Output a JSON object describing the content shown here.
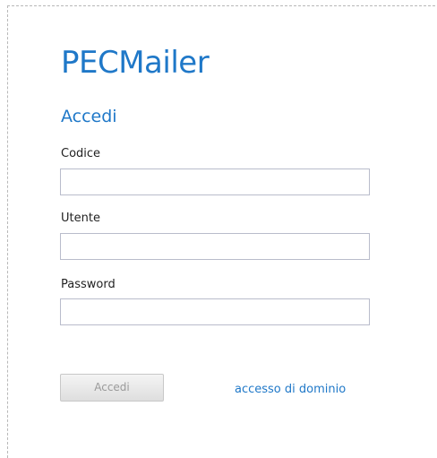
{
  "app": {
    "title": "PECMailer"
  },
  "form": {
    "heading": "Accedi",
    "fields": [
      {
        "label": "Codice",
        "value": "",
        "placeholder": ""
      },
      {
        "label": "Utente",
        "value": "",
        "placeholder": ""
      },
      {
        "label": "Password",
        "value": "",
        "placeholder": ""
      }
    ],
    "submit_label": "Accedi",
    "domain_link": "accesso di dominio"
  },
  "colors": {
    "accent": "#1f78c8",
    "label_text": "#222222",
    "input_border": "#b9bccb",
    "disabled_button_text": "#9a9a9a"
  }
}
